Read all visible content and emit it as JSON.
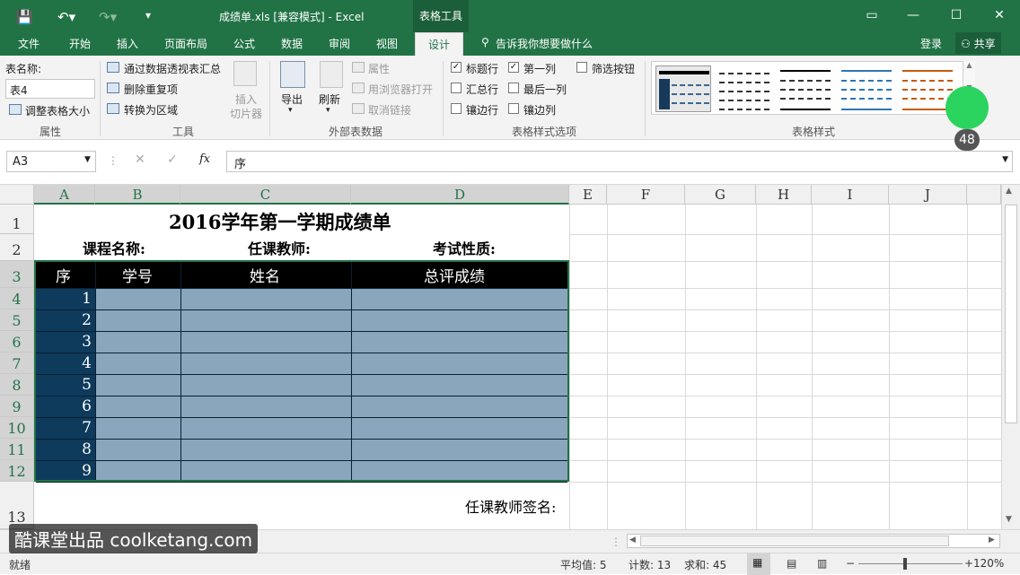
{
  "titlebar": {
    "title": "成绩单.xls  [兼容模式] - Excel",
    "context_tools": "表格工具"
  },
  "tabs": [
    "文件",
    "开始",
    "插入",
    "页面布局",
    "公式",
    "数据",
    "审阅",
    "视图"
  ],
  "active_tab": "设计",
  "tell_me": "告诉我你想要做什么",
  "login": "登录",
  "share": "共享",
  "ribbon": {
    "props": {
      "table_name_label": "表名称:",
      "table_name": "表4",
      "resize": "调整表格大小",
      "group": "属性"
    },
    "tools": {
      "pivot": "通过数据透视表汇总",
      "remove_dup": "删除重复项",
      "convert": "转换为区域",
      "slicer1": "插入",
      "slicer2": "切片器",
      "group": "工具"
    },
    "external": {
      "export": "导出",
      "refresh": "刷新",
      "properties": "属性",
      "open_browser": "用浏览器打开",
      "unlink": "取消链接",
      "group": "外部表数据"
    },
    "options": {
      "header_row": "标题行",
      "total_row": "汇总行",
      "banded_rows": "镶边行",
      "first_col": "第一列",
      "last_col": "最后一列",
      "banded_cols": "镶边列",
      "filter_btn": "筛选按钮",
      "group": "表格样式选项"
    },
    "styles": {
      "group": "表格样式"
    }
  },
  "name_box": "A3",
  "formula": "序",
  "fx": "fx",
  "columns": [
    "A",
    "B",
    "C",
    "D",
    "E",
    "F",
    "G",
    "H",
    "I",
    "J"
  ],
  "rows": [
    "1",
    "2",
    "3",
    "4",
    "5",
    "6",
    "7",
    "8",
    "9",
    "10",
    "11",
    "12",
    "13"
  ],
  "sheet": {
    "title": "2016学年第一学期成绩单",
    "course": "课程名称:",
    "teacher": "任课教师:",
    "exam": "考试性质:",
    "headers": [
      "序",
      "学号",
      "姓名",
      "总评成绩"
    ],
    "seq": [
      "1",
      "2",
      "3",
      "4",
      "5",
      "6",
      "7",
      "8",
      "9"
    ],
    "sign": "任课教师签名:"
  },
  "status": {
    "ready": "就绪",
    "avg": "平均值: 5",
    "count": "计数: 13",
    "sum": "求和: 45",
    "zoom": "120%"
  },
  "watermark": "酷课堂出品 coolketang.com",
  "badge": "48",
  "colors": {
    "excel_green": "#217346",
    "table_header": "#000000",
    "seq_fill": "#0e3a5c",
    "body_fill": "#8aa6bc"
  }
}
